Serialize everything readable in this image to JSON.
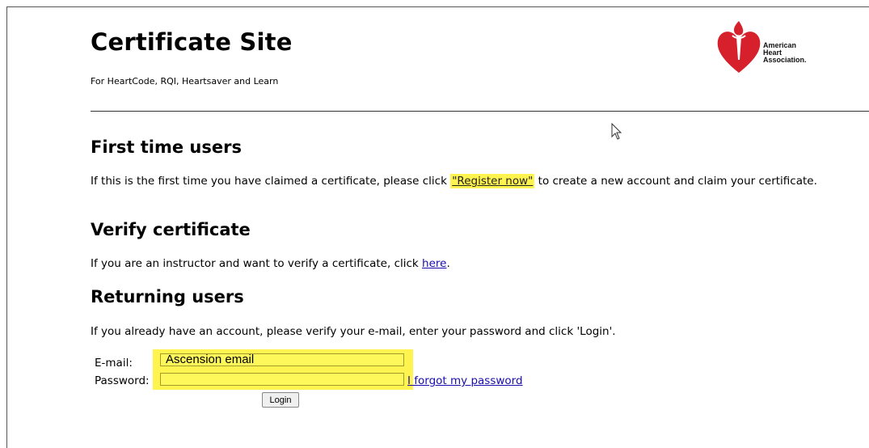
{
  "header": {
    "title": "Certificate Site",
    "subtitle": "For HeartCode, RQI, Heartsaver and Learn",
    "logo": {
      "line1": "American",
      "line2": "Heart",
      "line3": "Association.",
      "icon": "heart-torch-logo-icon",
      "color": "#d6202b"
    }
  },
  "first_time": {
    "heading": "First time users",
    "text_before": "If this is the first time you have claimed a certificate, please click ",
    "link": "\"Register now\"",
    "text_after": " to create a new account and claim your certificate."
  },
  "verify": {
    "heading": "Verify certificate",
    "text_before": "If you are an instructor and want to verify a certificate, click ",
    "link": "here",
    "text_after": "."
  },
  "returning": {
    "heading": "Returning users",
    "text": "If you already have an account, please verify your e-mail, enter your password and click 'Login'.",
    "email_label": "E-mail:",
    "email_value": "Ascension email",
    "password_label": "Password:",
    "password_value": "",
    "forgot_link": "I forgot my password",
    "login_button": "Login"
  },
  "colors": {
    "highlight": "#fff44f",
    "link": "#1a0dab"
  }
}
